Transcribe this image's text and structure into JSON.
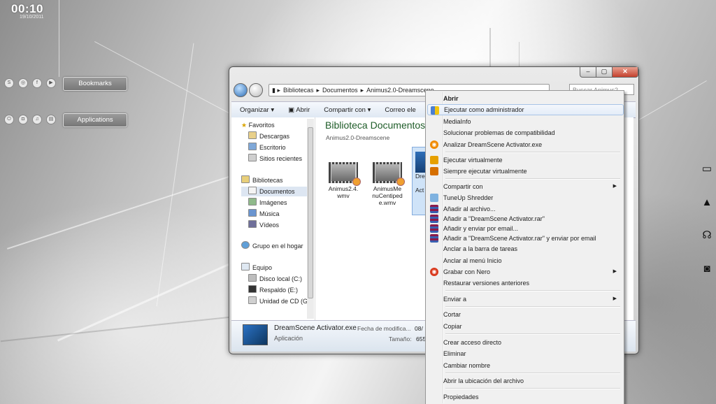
{
  "gadgets": {
    "clock_time": "00:10",
    "clock_date": "19/10/2011",
    "bookmarks_label": "Bookmarks",
    "applications_label": "Applications"
  },
  "right_dock": {
    "icons": [
      "monitor-icon",
      "triangle-icon",
      "headphones-icon",
      "camera-icon"
    ]
  },
  "explorer": {
    "breadcrumb": [
      "Bibliotecas",
      "Documentos",
      "Animus2.0-Dreamscene"
    ],
    "search_placeholder": "Buscar Animus2...",
    "toolbar": {
      "organize": "Organizar",
      "open": "Abrir",
      "share": "Compartir con",
      "email": "Correo ele"
    },
    "nav": {
      "favorites": "Favoritos",
      "downloads": "Descargas",
      "desktop": "Escritorio",
      "recent": "Sitios recientes",
      "libraries": "Bibliotecas",
      "documents": "Documentos",
      "pictures": "Imágenes",
      "music": "Música",
      "videos": "Vídeos",
      "homegroup": "Grupo en el hogar",
      "computer": "Equipo",
      "disk_c": "Disco local (C:)",
      "disk_e": "Respaldo (E:)",
      "cd": "Unidad de CD (G"
    },
    "content": {
      "title": "Biblioteca Documentos",
      "subtitle": "Animus2.0-Dreamscene",
      "files": [
        {
          "line1": "Animus2.4.",
          "line2": "wmv",
          "line3": ""
        },
        {
          "line1": "AnimusMe",
          "line2": "nuCentiped",
          "line3": "e.wmv"
        },
        {
          "line1": "Dre",
          "line2": "",
          "line3": "Act"
        }
      ]
    },
    "details": {
      "name": "DreamScene Activator.exe",
      "type": "Aplicación",
      "modified_label": "Fecha de modifica...",
      "modified_value": "08/",
      "size_label": "Tamaño:",
      "size_value": "655"
    }
  },
  "context_menu": {
    "items": [
      {
        "label": "Abrir",
        "bold": true
      },
      {
        "label": "Ejecutar como administrador",
        "highlighted": true
      },
      {
        "label": "MediaInfo"
      },
      {
        "label": "Solucionar problemas de compatibilidad"
      },
      {
        "label": "Analizar DreamScene Activator.exe"
      },
      {
        "label": "Ejecutar virtualmente"
      },
      {
        "label": "Siempre ejecutar virtualmente"
      },
      {
        "label": "Compartir con",
        "submenu": true
      },
      {
        "label": "TuneUp Shredder"
      },
      {
        "label": "Añadir al archivo..."
      },
      {
        "label": "Añadir a \"DreamScene Activator.rar\""
      },
      {
        "label": "Añadir y enviar por email..."
      },
      {
        "label": "Añadir a \"DreamScene Activator.rar\" y enviar por email"
      },
      {
        "label": "Anclar a la barra de tareas"
      },
      {
        "label": "Anclar al menú Inicio"
      },
      {
        "label": "Grabar con Nero",
        "submenu": true
      },
      {
        "label": "Restaurar versiones anteriores"
      },
      {
        "label": "Enviar a",
        "submenu": true
      },
      {
        "label": "Cortar"
      },
      {
        "label": "Copiar"
      },
      {
        "label": "Crear acceso directo"
      },
      {
        "label": "Eliminar"
      },
      {
        "label": "Cambiar nombre"
      },
      {
        "label": "Abrir la ubicación del archivo"
      },
      {
        "label": "Propiedades"
      }
    ],
    "submenu_arrow": "▶"
  }
}
